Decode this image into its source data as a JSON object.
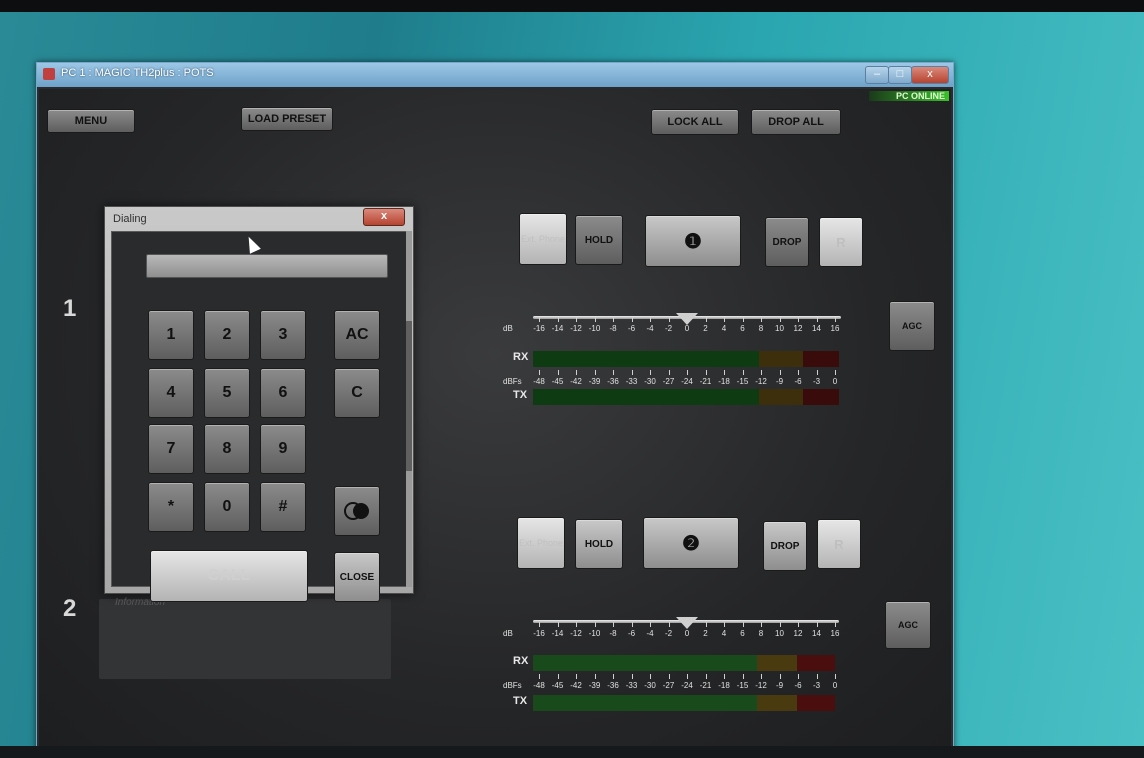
{
  "window": {
    "title": "PC 1 : MAGIC TH2plus : POTS",
    "min_glyph": "–",
    "max_glyph": "□",
    "close_glyph": "x"
  },
  "status": "PC ONLINE",
  "toolbar": {
    "menu": "MENU",
    "load_preset": "LOAD PRESET",
    "lock_all": "LOCK ALL",
    "drop_all": "DROP ALL"
  },
  "info_label": "Information",
  "lines": [
    {
      "number": "1",
      "ext_phone": "Ext. Phone",
      "hold": "HOLD",
      "line_icon": "❶",
      "drop": "DROP",
      "r": "R",
      "agc": "AGC",
      "level_db": 0,
      "rx_label": "RX",
      "tx_label": "TX",
      "dbfs_label": "dBFs",
      "db_label": "dB"
    },
    {
      "number": "2",
      "ext_phone": "Ext. Phone",
      "hold": "HOLD",
      "line_icon": "❷",
      "drop": "DROP",
      "r": "R",
      "agc": "AGC",
      "level_db": 0,
      "rx_label": "RX",
      "tx_label": "TX",
      "dbfs_label": "dBFs",
      "db_label": "dB"
    }
  ],
  "slider_scale": [
    "-16",
    "-14",
    "-12",
    "-10",
    "-8",
    "-6",
    "-4",
    "-2",
    "0",
    "2",
    "4",
    "6",
    "8",
    "10",
    "12",
    "14",
    "16"
  ],
  "meter_scale": [
    "-48",
    "-45",
    "-42",
    "-39",
    "-36",
    "-33",
    "-30",
    "-27",
    "-24",
    "-21",
    "-18",
    "-15",
    "-12",
    "-9",
    "-6",
    "-3",
    "0"
  ],
  "dialog": {
    "title": "Dialing",
    "close_glyph": "x",
    "field_value": "",
    "keys": [
      "1",
      "2",
      "3",
      "4",
      "5",
      "6",
      "7",
      "8",
      "9",
      "*",
      "0",
      "#"
    ],
    "ac": "AC",
    "c": "C",
    "call": "CALL",
    "close": "CLOSE"
  },
  "colors": {
    "meter_green": "#0f3b12",
    "meter_yellow": "#3d2e0c",
    "meter_red": "#3a0b0b",
    "online_green": "#3bbf2b"
  }
}
